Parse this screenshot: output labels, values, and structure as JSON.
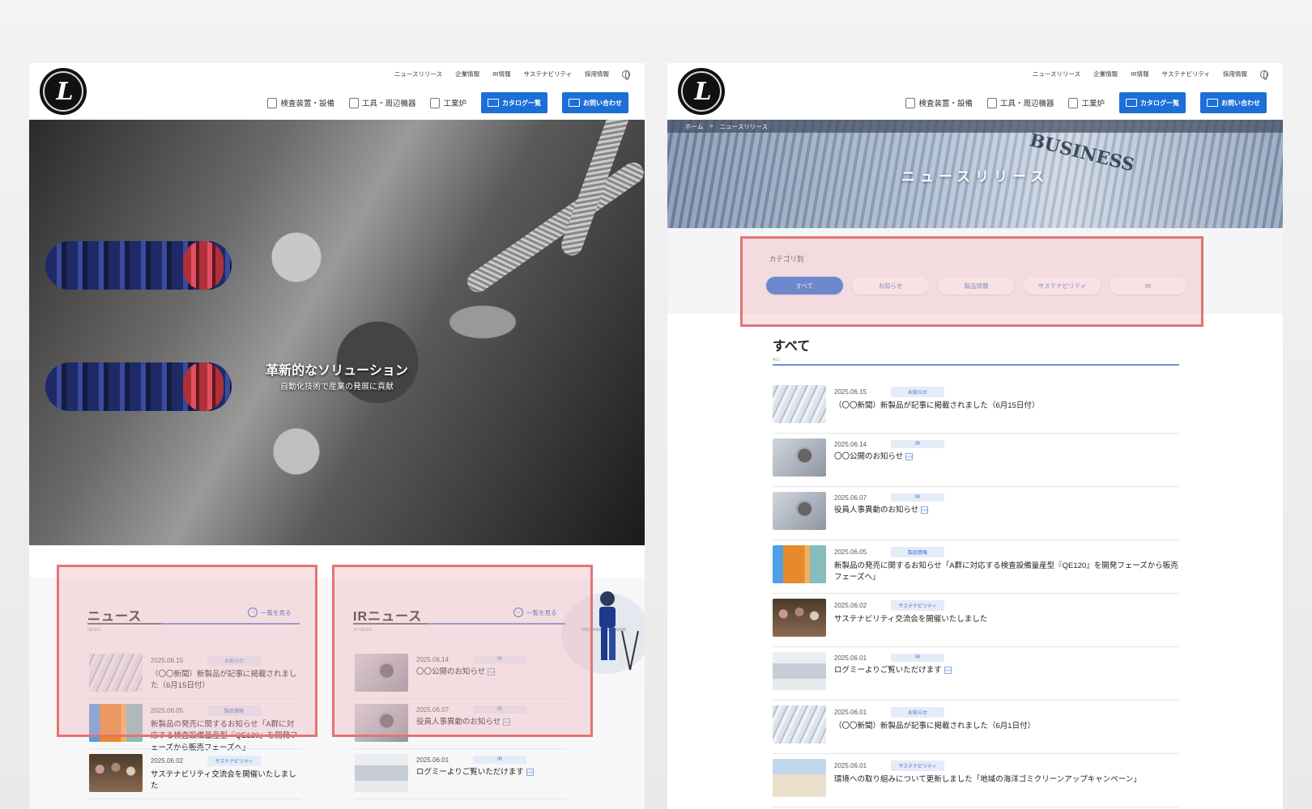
{
  "header": {
    "logo_text": "L",
    "util_links": [
      "ニュースリリース",
      "企業情報",
      "IR情報",
      "サステナビリティ",
      "採用情報"
    ],
    "nav": [
      {
        "label": "検査装置・設備",
        "icon": "inspection-icon"
      },
      {
        "label": "工具・周辺機器",
        "icon": "tool-icon"
      },
      {
        "label": "工業炉",
        "icon": "furnace-icon"
      }
    ],
    "catalog_label": "カタログ一覧",
    "contact_label": "お問い合わせ"
  },
  "hero": {
    "title": "革新的なソリューション",
    "subtitle": "自動化技術で産業の発展に貢献"
  },
  "news": {
    "title": "ニュース",
    "en": "NEWS",
    "more": "一覧を見る",
    "items": [
      {
        "date": "2025.06.15",
        "tag": "お知らせ",
        "text": "（〇〇新聞）新製品が記事に掲載されました（6月15日付）",
        "thumb": "paper"
      },
      {
        "date": "2025.06.05",
        "tag": "製品情報",
        "text": "新製品の発売に関するお知らせ「A群に対応する検査設備量産型『QE120』を開発フェーズから販売フェーズへ」",
        "thumb": "pipe"
      },
      {
        "date": "2025.06.02",
        "tag": "サステナビリティ",
        "text": "サステナビリティ交流会を開催いたしました",
        "thumb": "crowd"
      }
    ]
  },
  "ir_news": {
    "title": "IRニュース",
    "en": "IR NEWS",
    "more": "一覧を見る",
    "items": [
      {
        "date": "2025.06.14",
        "tag": "IR",
        "text": "〇〇公開のお知らせ",
        "thumb": "mag",
        "pdf": "PDF"
      },
      {
        "date": "2025.06.07",
        "tag": "IR",
        "text": "役員人事異動のお知らせ",
        "thumb": "mag",
        "pdf": "PDF"
      },
      {
        "date": "2025.06.01",
        "tag": "IR",
        "text": "ログミーよりご覧いただけます",
        "thumb": "laptop",
        "pdf": "PDF"
      }
    ]
  },
  "page2": {
    "breadcrumb": [
      "ホーム",
      ">",
      "ニュースリリース"
    ],
    "hero_word": "BUSINESS",
    "title": "ニュースリリース",
    "category_label": "カテゴリ別",
    "categories": [
      "すべて",
      "お知らせ",
      "製品情報",
      "サステナビリティ",
      "IR"
    ],
    "list_title": "すべて",
    "list_en": "ALL",
    "items": [
      {
        "date": "2025.06.15",
        "tag": "お知らせ",
        "text": "（〇〇新聞）新製品が記事に掲載されました（6月15日付）",
        "thumb": "paper",
        "pdf": ""
      },
      {
        "date": "2025.06.14",
        "tag": "IR",
        "text": "〇〇公開のお知らせ",
        "thumb": "mag",
        "pdf": "PDF"
      },
      {
        "date": "2025.06.07",
        "tag": "IR",
        "text": "役員人事異動のお知らせ",
        "thumb": "mag",
        "pdf": "PDF"
      },
      {
        "date": "2025.06.05",
        "tag": "製品情報",
        "text": "新製品の発売に関するお知らせ「A群に対応する検査設備量産型『QE120』を開発フェーズから販売フェーズへ」",
        "thumb": "pipe",
        "pdf": ""
      },
      {
        "date": "2025.06.02",
        "tag": "サステナビリティ",
        "text": "サステナビリティ交流会を開催いたしました",
        "thumb": "crowd",
        "pdf": ""
      },
      {
        "date": "2025.06.01",
        "tag": "IR",
        "text": "ログミーよりご覧いただけます",
        "thumb": "laptop",
        "pdf": "PDF"
      },
      {
        "date": "2025.06.01",
        "tag": "お知らせ",
        "text": "（〇〇新聞）新製品が記事に掲載されました（6月1日付）",
        "thumb": "paper",
        "pdf": ""
      },
      {
        "date": "2025.06.01",
        "tag": "サステナビリティ",
        "text": "環境への取り組みについて更新しました「地域の海洋ゴミクリーンアップキャンペーン」",
        "thumb": "beach",
        "pdf": ""
      }
    ]
  },
  "colors": {
    "accent": "#1d6fd8",
    "highlight": "#e57373",
    "tag_bg": "#e4ecf8"
  }
}
